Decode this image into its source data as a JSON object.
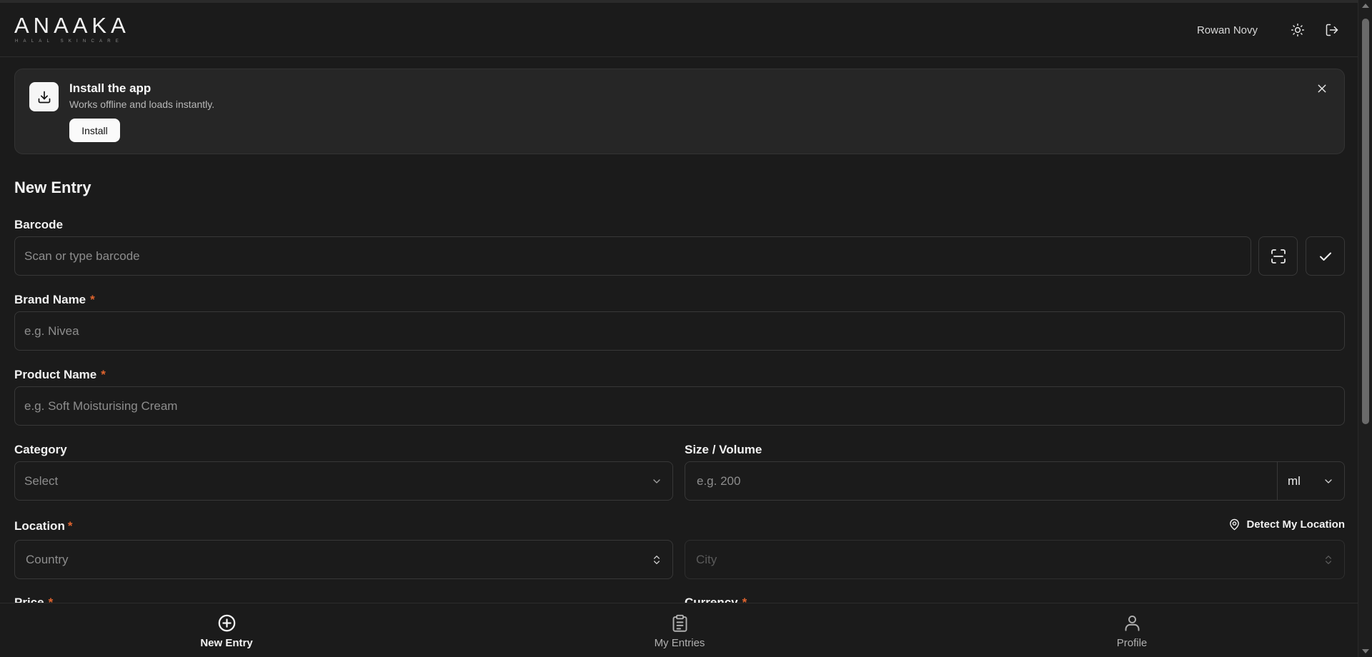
{
  "header": {
    "logo_main": "ANAAKA",
    "logo_sub": "HALAL SKINCARE",
    "user_name": "Rowan Novy",
    "theme_icon": "sun-icon",
    "logout_icon": "logout-icon"
  },
  "install_banner": {
    "title": "Install the app",
    "subtitle": "Works offline and loads instantly.",
    "install_label": "Install",
    "icon": "download-icon",
    "close_icon": "close-icon"
  },
  "form": {
    "title": "New Entry",
    "required_mark": "*",
    "barcode": {
      "label": "Barcode",
      "placeholder": "Scan or type barcode",
      "scan_icon": "scan-icon",
      "confirm_icon": "check-icon"
    },
    "brand": {
      "label": "Brand Name",
      "placeholder": "e.g. Nivea",
      "required": true
    },
    "product": {
      "label": "Product Name",
      "placeholder": "e.g. Soft Moisturising Cream",
      "required": true
    },
    "category": {
      "label": "Category",
      "value": "Select"
    },
    "size": {
      "label": "Size / Volume",
      "placeholder": "e.g. 200",
      "unit": "ml"
    },
    "location": {
      "label": "Location",
      "required": true,
      "country_placeholder": "Country",
      "city_placeholder": "City",
      "detect_label": "Detect My Location",
      "detect_icon": "map-pin-icon"
    },
    "price": {
      "label": "Price",
      "required": true
    },
    "currency": {
      "label": "Currency",
      "required": true
    }
  },
  "bottom_nav": [
    {
      "label": "New Entry",
      "icon": "plus-circle-icon",
      "active": true
    },
    {
      "label": "My Entries",
      "icon": "clipboard-icon",
      "active": false
    },
    {
      "label": "Profile",
      "icon": "user-icon",
      "active": false
    }
  ]
}
